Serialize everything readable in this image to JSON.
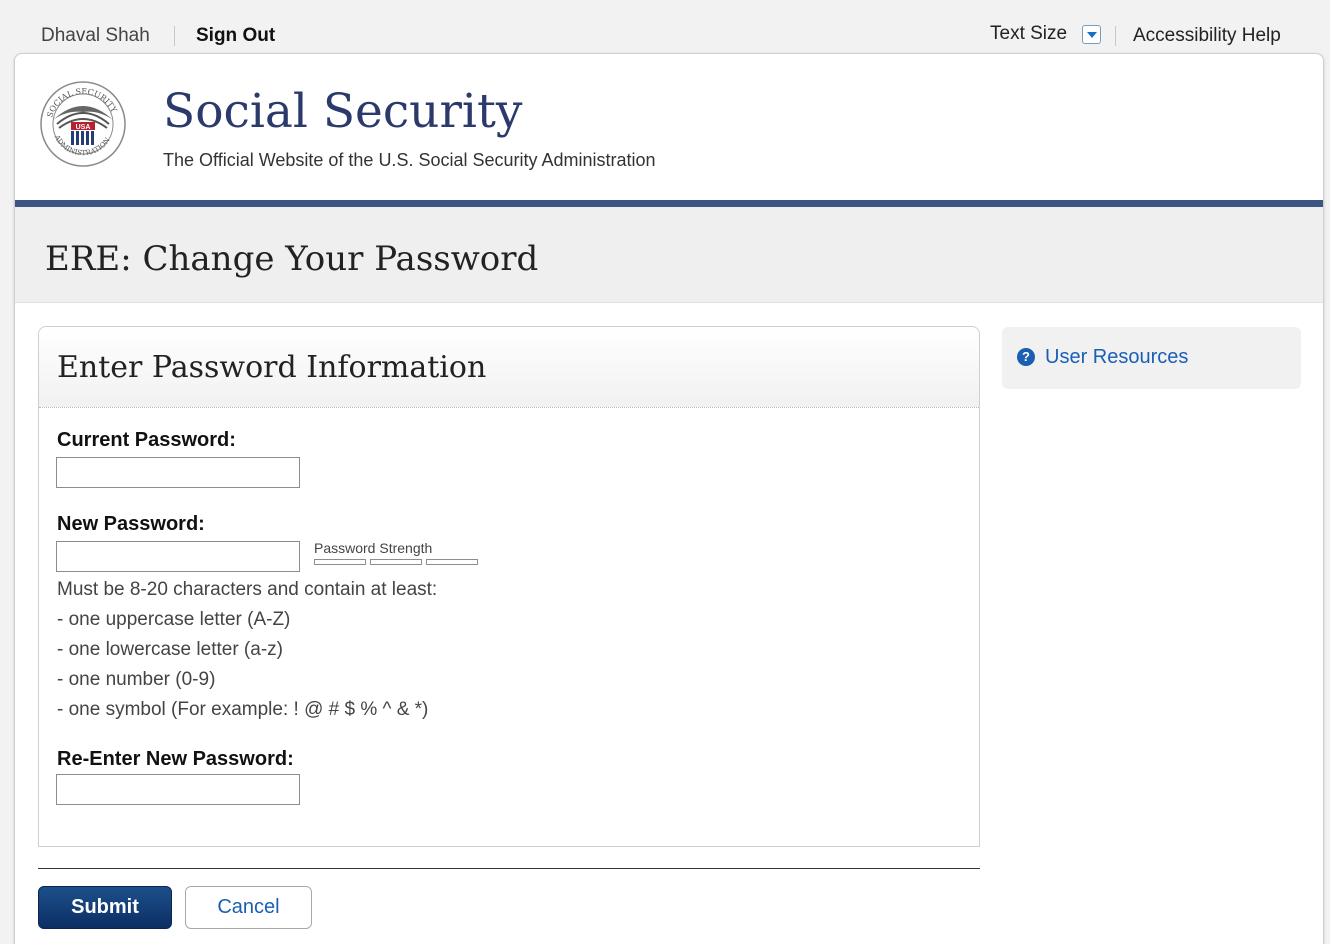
{
  "topbar": {
    "user_name": "Dhaval Shah",
    "sign_out": "Sign Out",
    "text_size": "Text Size",
    "accessibility_help": "Accessibility Help"
  },
  "header": {
    "site_title": "Social Security",
    "subtitle": "The Official Website of the U.S. Social Security Administration",
    "seal_icon": "ssa-seal-icon",
    "seal_lettering": [
      "SOCIAL SECURITY",
      "USA",
      "ADMINISTRATION"
    ],
    "brand_color": "#2b3a6b",
    "rule_color": "#3d5584"
  },
  "page": {
    "title": "ERE: Change Your Password"
  },
  "form": {
    "panel_title": "Enter Password Information",
    "current_password_label": "Current Password:",
    "current_password_value": "",
    "new_password_label": "New Password:",
    "new_password_value": "",
    "password_strength_label": "Password Strength",
    "password_strength_level": 0,
    "requirements": [
      "Must be 8-20 characters and contain at least:",
      "- one uppercase letter (A-Z)",
      "- one lowercase letter (a-z)",
      "- one number (0-9)",
      "- one symbol (For example: ! @ # $ % ^ & *)"
    ],
    "reenter_password_label": "Re-Enter New Password:",
    "reenter_password_value": ""
  },
  "actions": {
    "submit": "Submit",
    "cancel": "Cancel",
    "submit_color": "#0b2f63",
    "link_color": "#1a5fb4"
  },
  "sidebar": {
    "resources_icon": "help-question-icon",
    "resources_link": "User Resources"
  }
}
